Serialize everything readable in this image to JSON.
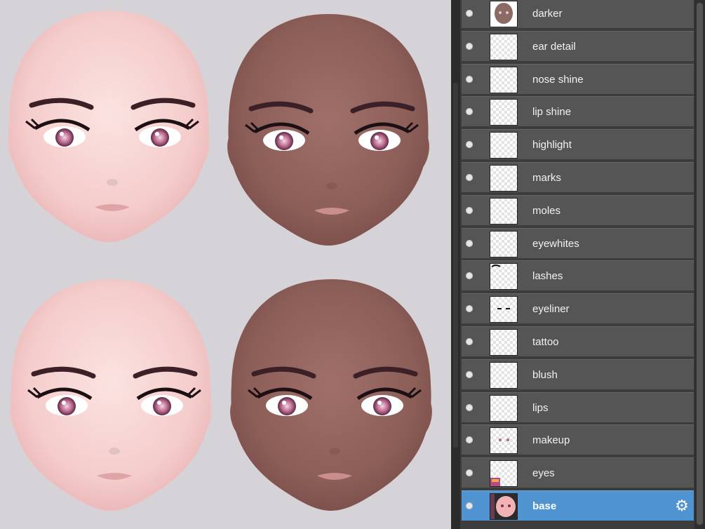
{
  "layers": [
    {
      "name": "darker",
      "thumb": "brown-face",
      "selected": false
    },
    {
      "name": "ear detail",
      "thumb": "transparent",
      "selected": false
    },
    {
      "name": "nose shine",
      "thumb": "transparent",
      "selected": false
    },
    {
      "name": "lip shine",
      "thumb": "transparent",
      "selected": false
    },
    {
      "name": "highlight",
      "thumb": "transparent",
      "selected": false
    },
    {
      "name": "marks",
      "thumb": "transparent",
      "selected": false
    },
    {
      "name": "moles",
      "thumb": "transparent",
      "selected": false
    },
    {
      "name": "eyewhites",
      "thumb": "transparent",
      "selected": false
    },
    {
      "name": "lashes",
      "thumb": "lashes",
      "selected": false
    },
    {
      "name": "eyeliner",
      "thumb": "eyeliner",
      "selected": false
    },
    {
      "name": "tattoo",
      "thumb": "transparent",
      "selected": false
    },
    {
      "name": "blush",
      "thumb": "transparent",
      "selected": false
    },
    {
      "name": "lips",
      "thumb": "transparent",
      "selected": false
    },
    {
      "name": "makeup",
      "thumb": "makeup",
      "selected": false
    },
    {
      "name": "eyes",
      "thumb": "eyes",
      "selected": false
    },
    {
      "name": "base",
      "thumb": "pink-face-base",
      "selected": true
    }
  ],
  "colors": {
    "selected": "#4f94d0",
    "layer_bg": "#555555",
    "canvas_bg": "#d6d3d8",
    "skin_light": "#f4c9c9",
    "skin_dark": "#8c5e58"
  },
  "icons": {
    "visibility": "eye-dot-icon",
    "settings": "gear-icon"
  }
}
